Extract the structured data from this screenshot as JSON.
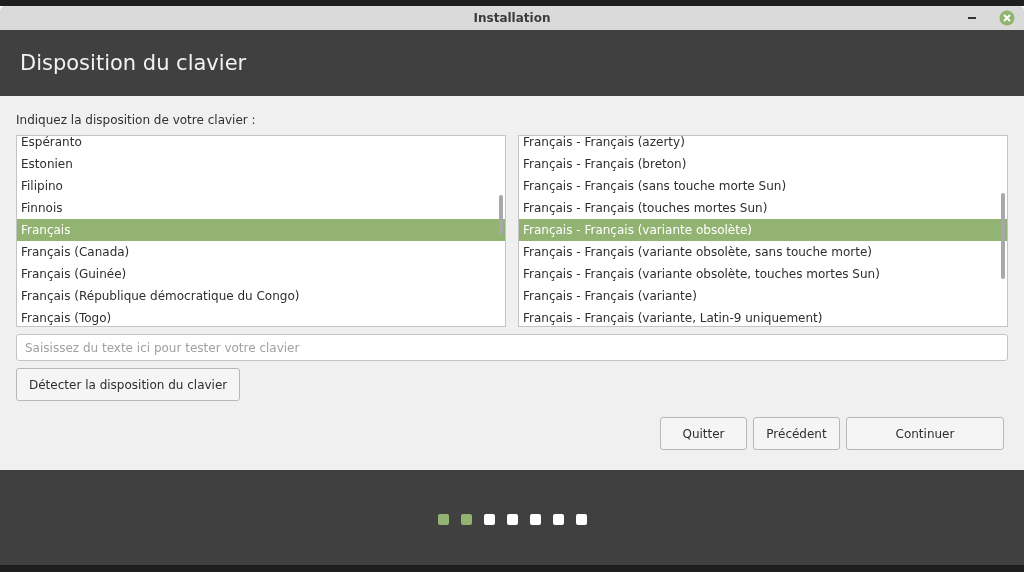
{
  "window": {
    "title": "Installation"
  },
  "header": {
    "title": "Disposition du clavier"
  },
  "prompt": "Indiquez la disposition de votre clavier :",
  "layouts": [
    {
      "label": "Espéranto",
      "selected": false
    },
    {
      "label": "Estonien",
      "selected": false
    },
    {
      "label": "Filipino",
      "selected": false
    },
    {
      "label": "Finnois",
      "selected": false
    },
    {
      "label": "Français",
      "selected": true
    },
    {
      "label": "Français (Canada)",
      "selected": false
    },
    {
      "label": "Français (Guinée)",
      "selected": false
    },
    {
      "label": "Français (République démocratique du Congo)",
      "selected": false
    },
    {
      "label": "Français (Togo)",
      "selected": false
    }
  ],
  "variants": [
    {
      "label": "Français - Français (azerty)",
      "selected": false
    },
    {
      "label": "Français - Français (breton)",
      "selected": false
    },
    {
      "label": "Français - Français (sans touche morte Sun)",
      "selected": false
    },
    {
      "label": "Français - Français (touches mortes Sun)",
      "selected": false
    },
    {
      "label": "Français - Français (variante obsolète)",
      "selected": true
    },
    {
      "label": "Français - Français (variante obsolète, sans touche morte)",
      "selected": false
    },
    {
      "label": "Français - Français (variante obsolète, touches mortes Sun)",
      "selected": false
    },
    {
      "label": "Français - Français (variante)",
      "selected": false
    },
    {
      "label": "Français - Français (variante, Latin-9 uniquement)",
      "selected": false
    }
  ],
  "test_field": {
    "placeholder": "Saisissez du texte ici pour tester votre clavier"
  },
  "detect_button": "Détecter la disposition du clavier",
  "buttons": [
    "Quitter",
    "Précédent",
    "Continuer"
  ],
  "steps": [
    {
      "done": true
    },
    {
      "done": true
    },
    {
      "done": false
    },
    {
      "done": false
    },
    {
      "done": false
    },
    {
      "done": false
    },
    {
      "done": false
    }
  ]
}
